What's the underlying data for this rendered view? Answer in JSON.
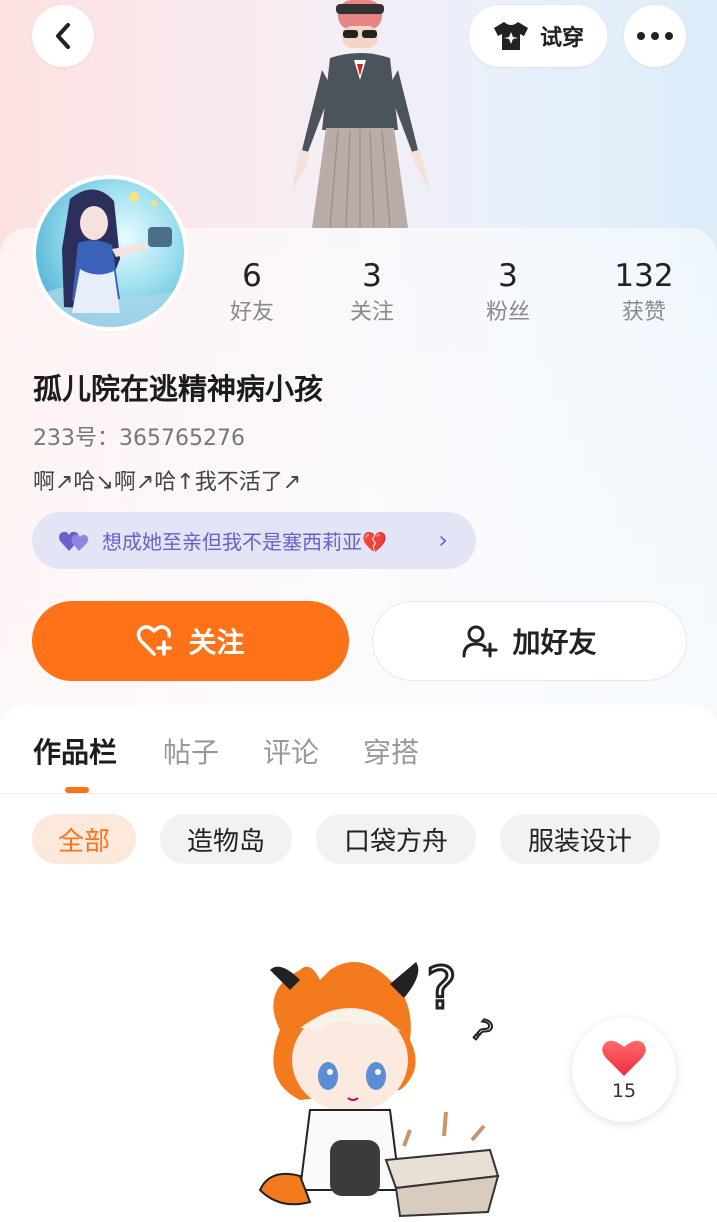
{
  "header": {
    "tryon_label": "试穿",
    "back_icon": "chevron-left-icon",
    "more_icon": "more-dots-icon"
  },
  "profile": {
    "stats": [
      {
        "value": "6",
        "label": "好友"
      },
      {
        "value": "3",
        "label": "关注"
      },
      {
        "value": "3",
        "label": "粉丝"
      },
      {
        "value": "132",
        "label": "获赞"
      }
    ],
    "username": "孤儿院在逃精神病小孩",
    "user_id": "233号：365765276",
    "bio": "啊↗哈↘啊↗哈↑我不活了↗",
    "badge_text": "想成她至亲但我不是塞西莉亚💔"
  },
  "actions": {
    "follow_label": "关注",
    "add_friend_label": "加好友"
  },
  "tabs": [
    {
      "label": "作品栏",
      "active": true
    },
    {
      "label": "帖子",
      "active": false
    },
    {
      "label": "评论",
      "active": false
    },
    {
      "label": "穿搭",
      "active": false
    }
  ],
  "filters": [
    {
      "label": "全部",
      "active": true
    },
    {
      "label": "造物岛",
      "active": false
    },
    {
      "label": "口袋方舟",
      "active": false
    },
    {
      "label": "服装设计",
      "active": false
    }
  ],
  "like_fab": {
    "count": "15"
  },
  "colors": {
    "accent": "#ff7217",
    "badge_text": "#6a61c8",
    "badge_bg": "#e3e4f6"
  }
}
